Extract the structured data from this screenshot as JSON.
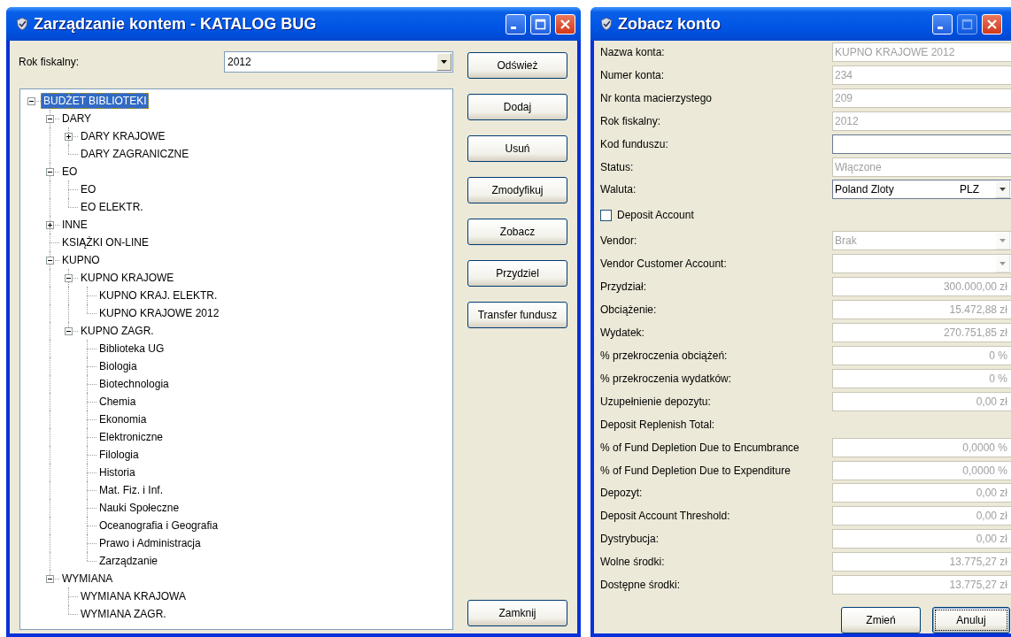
{
  "windows": [
    {
      "title": "Zarządzanie kontem - KATALOG BUG",
      "controls": [
        {
          "kind": "minimize",
          "disabled": false
        },
        {
          "kind": "maximize",
          "disabled": false
        },
        {
          "kind": "close",
          "disabled": false
        }
      ],
      "fiscal_year": {
        "label": "Rok fiskalny:",
        "value": "2012"
      },
      "tree": [
        {
          "label": "BUDŻET BIBLIOTEKI",
          "selected": true,
          "expanded": true,
          "children": [
            {
              "label": "DARY",
              "selected": false,
              "expanded": true,
              "children": [
                {
                  "label": "DARY KRAJOWE",
                  "selected": false,
                  "expanded": false
                },
                {
                  "label": "DARY ZAGRANICZNE",
                  "selected": false
                }
              ]
            },
            {
              "label": "EO",
              "selected": false,
              "expanded": true,
              "children": [
                {
                  "label": "EO",
                  "selected": false
                },
                {
                  "label": "EO ELEKTR.",
                  "selected": false
                }
              ]
            },
            {
              "label": "INNE",
              "selected": false,
              "expanded": false
            },
            {
              "label": "KSIĄŻKI ON-LINE",
              "selected": false
            },
            {
              "label": "KUPNO",
              "selected": false,
              "expanded": true,
              "children": [
                {
                  "label": "KUPNO KRAJOWE",
                  "selected": false,
                  "expanded": true,
                  "children": [
                    {
                      "label": "KUPNO KRAJ. ELEKTR.",
                      "selected": false
                    },
                    {
                      "label": "KUPNO KRAJOWE 2012",
                      "selected": false
                    }
                  ]
                },
                {
                  "label": "KUPNO ZAGR.",
                  "selected": false,
                  "expanded": true,
                  "children": [
                    {
                      "label": "Biblioteka UG",
                      "selected": false
                    },
                    {
                      "label": "Biologia",
                      "selected": false
                    },
                    {
                      "label": "Biotechnologia",
                      "selected": false
                    },
                    {
                      "label": "Chemia",
                      "selected": false
                    },
                    {
                      "label": "Ekonomia",
                      "selected": false
                    },
                    {
                      "label": "Elektroniczne",
                      "selected": false
                    },
                    {
                      "label": "Filologia",
                      "selected": false
                    },
                    {
                      "label": "Historia",
                      "selected": false
                    },
                    {
                      "label": "Mat. Fiz. i Inf.",
                      "selected": false
                    },
                    {
                      "label": "Nauki Społeczne",
                      "selected": false
                    },
                    {
                      "label": "Oceanografia i Geografia",
                      "selected": false
                    },
                    {
                      "label": "Prawo i Administracja",
                      "selected": false
                    },
                    {
                      "label": "Zarządzanie",
                      "selected": false
                    }
                  ]
                }
              ]
            },
            {
              "label": "WYMIANA",
              "selected": false,
              "expanded": true,
              "children": [
                {
                  "label": "WYMIANA KRAJOWA",
                  "selected": false
                },
                {
                  "label": "WYMIANA ZAGR.",
                  "selected": false
                }
              ]
            }
          ]
        }
      ],
      "buttons": [
        "Odśwież",
        "Dodaj",
        "Usuń",
        "Zmodyfikuj",
        "Zobacz",
        "Przydziel",
        "Transfer fundusz"
      ],
      "close_button": "Zamknij"
    },
    {
      "title": "Zobacz konto",
      "controls": [
        {
          "kind": "minimize",
          "disabled": false
        },
        {
          "kind": "maximize",
          "disabled": true
        },
        {
          "kind": "close",
          "disabled": false
        }
      ],
      "fields": [
        {
          "kind": "text",
          "label": "Nazwa konta:",
          "value": "KUPNO KRAJOWE 2012",
          "disabled": true
        },
        {
          "kind": "text",
          "label": "Numer konta:",
          "value": "234",
          "disabled": true
        },
        {
          "kind": "text",
          "label": "Nr konta macierzystego",
          "value": "209",
          "disabled": true
        },
        {
          "kind": "text",
          "label": "Rok fiskalny:",
          "value": "2012",
          "disabled": true
        },
        {
          "kind": "text",
          "label": "Kod funduszu:",
          "disabled": false
        },
        {
          "kind": "text",
          "label": "Status:",
          "value": "Włączone",
          "disabled": true
        },
        {
          "kind": "combo",
          "label": "Waluta:",
          "value": "Poland Zloty",
          "code": "PLZ",
          "disabled": false
        },
        {
          "kind": "checkbox",
          "label": "Deposit Account",
          "checked": false
        },
        {
          "kind": "combo",
          "label": "Vendor:",
          "value": "Brak",
          "disabled": true
        },
        {
          "kind": "combo",
          "label": "Vendor Customer Account:",
          "disabled": true
        },
        {
          "kind": "amount",
          "label": "Przydział:",
          "value": "300.000,00 zł",
          "disabled": true
        },
        {
          "kind": "amount",
          "label": "Obciążenie:",
          "value": "15.472,88 zł",
          "disabled": true
        },
        {
          "kind": "amount",
          "label": "Wydatek:",
          "value": "270.751,85 zł",
          "disabled": true
        },
        {
          "kind": "amount",
          "label": "% przekroczenia obciążeń:",
          "value": "0 %",
          "disabled": true
        },
        {
          "kind": "amount",
          "label": "% przekroczenia wydatków:",
          "value": "0 %",
          "disabled": true
        },
        {
          "kind": "amount",
          "label": "Uzupełnienie depozytu:",
          "value": "0,00 zł",
          "disabled": true
        },
        {
          "kind": "label",
          "label": "Deposit Replenish Total:"
        },
        {
          "kind": "amount",
          "label": "% of Fund Depletion Due to Encumbrance",
          "value": "0,0000 %",
          "disabled": true
        },
        {
          "kind": "amount",
          "label": "% of Fund Depletion Due to Expenditure",
          "value": "0,0000 %",
          "disabled": true
        },
        {
          "kind": "amount",
          "label": "Depozyt:",
          "value": "0,00 zł",
          "disabled": true
        },
        {
          "kind": "amount",
          "label": "Deposit Account Threshold:",
          "value": "0,00 zł",
          "disabled": true
        },
        {
          "kind": "amount",
          "label": "Dystrybucja:",
          "value": "0,00 zł",
          "disabled": true
        },
        {
          "kind": "amount",
          "label": "Wolne środki:",
          "value": "13.775,27 zł",
          "disabled": true
        },
        {
          "kind": "amount",
          "label": "Dostępne środki:",
          "value": "13.775,27 zł",
          "disabled": true
        }
      ],
      "buttons": [
        {
          "label": "Zmień",
          "default": false
        },
        {
          "label": "Anuluj",
          "default": true
        }
      ]
    }
  ]
}
